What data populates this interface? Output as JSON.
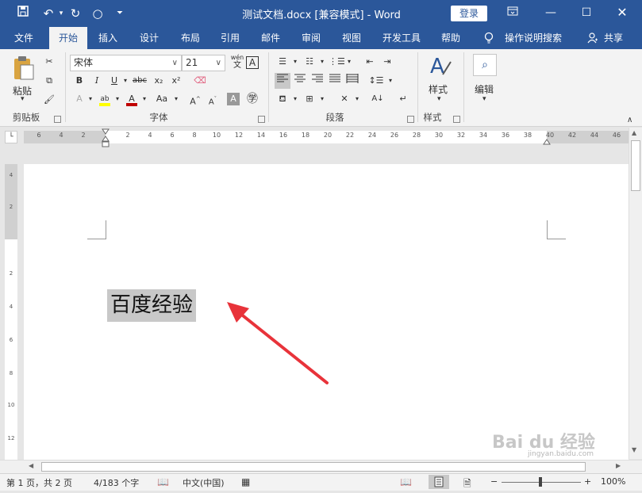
{
  "window": {
    "title": "测试文档.docx [兼容模式]  -  Word",
    "login": "登录",
    "share": "共享"
  },
  "tabs": [
    "文件",
    "开始",
    "插入",
    "设计",
    "布局",
    "引用",
    "邮件",
    "审阅",
    "视图",
    "开发工具",
    "帮助"
  ],
  "active_tab": "开始",
  "tell_me": "操作说明搜索",
  "ribbon": {
    "clipboard": {
      "label": "剪贴板",
      "paste": "粘贴"
    },
    "font": {
      "label": "字体",
      "name": "宋体",
      "size": "21",
      "phonetic": "wén",
      "phonetic2": "文",
      "case": "Aa"
    },
    "paragraph": {
      "label": "段落"
    },
    "styles": {
      "label": "样式",
      "button": "样式"
    },
    "editing": {
      "button": "编辑"
    }
  },
  "ruler": {
    "left_ticks": [
      "6",
      "4",
      "2"
    ],
    "right_ticks": [
      "2",
      "4",
      "6",
      "8",
      "10",
      "12",
      "14",
      "16",
      "18",
      "20",
      "22",
      "24",
      "26",
      "28",
      "30",
      "32",
      "34",
      "36",
      "38",
      "40",
      "42",
      "44",
      "46"
    ],
    "v_ticks": [
      "4",
      "2",
      "",
      "2",
      "4",
      "6",
      "8",
      "10",
      "12"
    ]
  },
  "document": {
    "text": "百度经验"
  },
  "status": {
    "page": "第 1 页，共 2 页",
    "words": "4/183 个字",
    "language": "中文(中国)",
    "zoom": "100%"
  },
  "watermark": {
    "brand": "Bai du 经验",
    "url": "jingyan.baidu.com"
  },
  "colors": {
    "accent": "#2b579a",
    "highlight": "#ffff00",
    "font_color": "#c00000",
    "arrow": "#e8333a"
  }
}
